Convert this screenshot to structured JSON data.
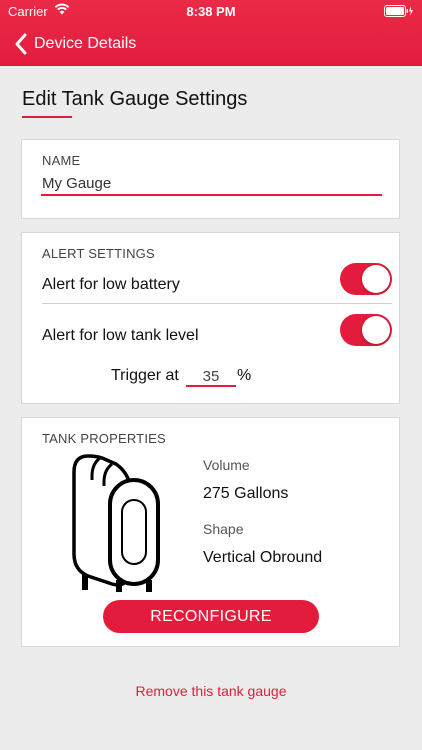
{
  "status_bar": {
    "carrier": "Carrier",
    "time": "8:38 PM"
  },
  "nav": {
    "back_label": "Device Details"
  },
  "page": {
    "title": "Edit Tank Gauge Settings"
  },
  "name_section": {
    "label": "NAME",
    "value": "My Gauge"
  },
  "alert_section": {
    "label": "ALERT SETTINGS",
    "low_battery_label": "Alert for low battery",
    "low_battery_on": true,
    "low_tank_label": "Alert for low tank level",
    "low_tank_on": true,
    "trigger_label": "Trigger at",
    "trigger_value": "35",
    "trigger_unit": "%"
  },
  "tank_section": {
    "label": "TANK PROPERTIES",
    "volume_label": "Volume",
    "volume_value": "275 Gallons",
    "shape_label": "Shape",
    "shape_value": "Vertical Obround",
    "reconfigure_label": "RECONFIGURE"
  },
  "footer": {
    "remove_label": "Remove this tank gauge"
  },
  "colors": {
    "accent": "#e31c3d",
    "background": "#ececec",
    "card": "#ffffff"
  }
}
